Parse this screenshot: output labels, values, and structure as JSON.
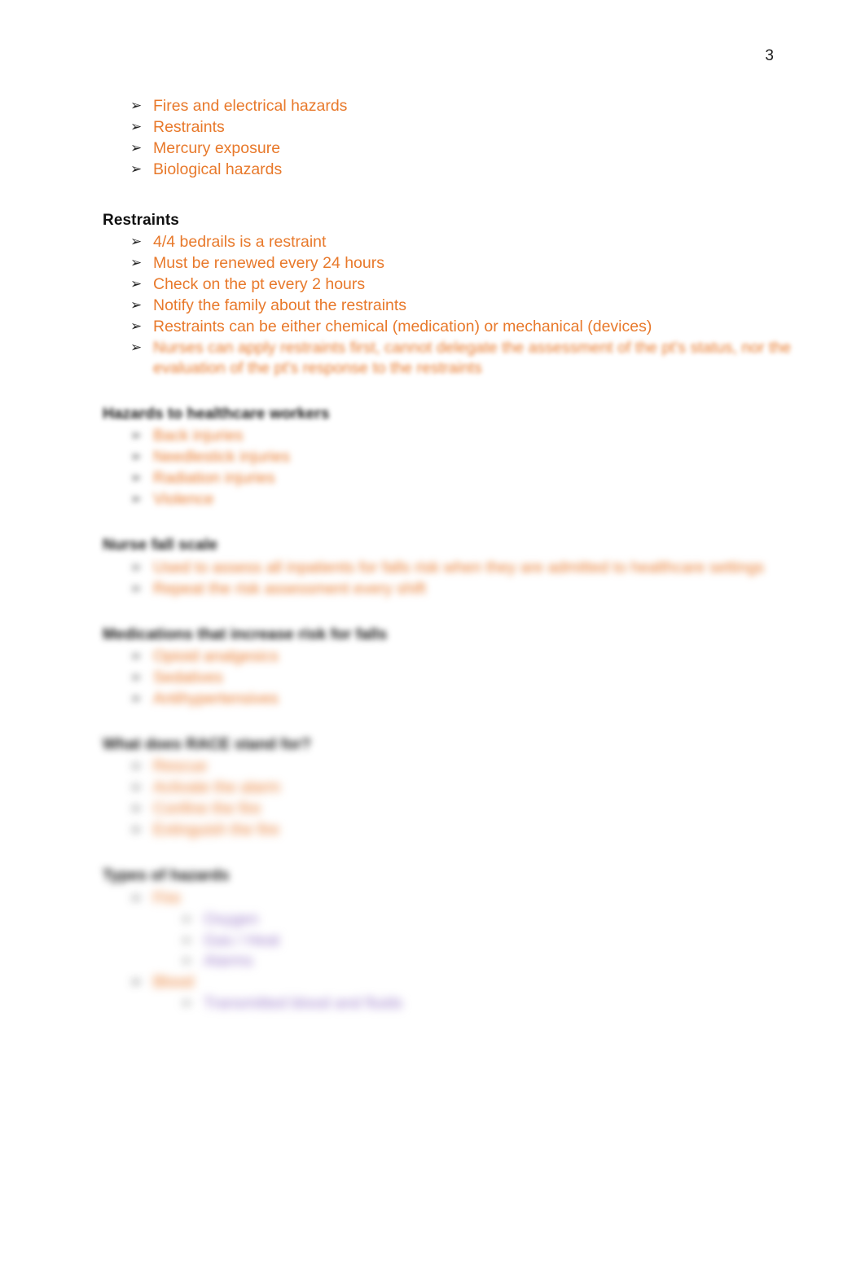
{
  "document": {
    "page_number": "3",
    "colors": {
      "bullet_orange": "#e8792b",
      "bullet_purple": "#9a7bc8",
      "heading_black": "#111111",
      "page_background": "#ffffff"
    },
    "bullet_glyph": "➢"
  },
  "intro_list": {
    "items": [
      {
        "text": "Fires and electrical hazards"
      },
      {
        "text": "Restraints"
      },
      {
        "text": "Mercury exposure"
      },
      {
        "text": "Biological hazards"
      }
    ]
  },
  "sections": [
    {
      "heading": "Restraints",
      "heading_legible": true,
      "items": [
        {
          "text": "4/4 bedrails is a restraint",
          "legible": true
        },
        {
          "text": "Must be renewed every 24 hours",
          "legible": true
        },
        {
          "text": "Check on the pt every 2 hours",
          "legible": true
        },
        {
          "text": "Notify the family about the restraints",
          "legible": true
        },
        {
          "text": "Restraints can be either chemical (medication) or mechanical (devices)",
          "legible": true
        },
        {
          "text": "Nurses can apply restraints first, cannot delegate the assessment of the pt's status, nor the evaluation of the pt's response to the restraints",
          "legible": false
        }
      ]
    },
    {
      "heading": "Hazards to healthcare workers",
      "heading_legible": false,
      "items": [
        {
          "text": "Back injuries",
          "legible": false
        },
        {
          "text": "Needlestick injuries",
          "legible": false
        },
        {
          "text": "Radiation injuries",
          "legible": false
        },
        {
          "text": "Violence",
          "legible": false
        }
      ]
    },
    {
      "heading": "Nurse fall scale",
      "heading_legible": false,
      "items": [
        {
          "text": "Used to assess all inpatients for falls risk when they are admitted to healthcare settings",
          "legible": false
        },
        {
          "text": "Repeat the risk assessment every shift",
          "legible": false
        }
      ]
    },
    {
      "heading": "Medications that increase risk for falls",
      "heading_legible": false,
      "items": [
        {
          "text": "Opioid analgesics",
          "legible": false
        },
        {
          "text": "Sedatives",
          "legible": false
        },
        {
          "text": "Antihypertensives",
          "legible": false
        }
      ]
    },
    {
      "heading": "What does RACE stand for?",
      "heading_legible": false,
      "items": [
        {
          "text": "Rescue",
          "legible": false
        },
        {
          "text": "Activate the alarm",
          "legible": false
        },
        {
          "text": "Confine the fire",
          "legible": false
        },
        {
          "text": "Extinguish the fire",
          "legible": false
        }
      ]
    },
    {
      "heading": "Types of hazards",
      "heading_legible": false,
      "items": [
        {
          "text": "Fire",
          "legible": false,
          "subitems": [
            {
              "text": "Oxygen",
              "legible": false
            },
            {
              "text": "Gas / Heat",
              "legible": false
            },
            {
              "text": "Alarms",
              "legible": false
            }
          ]
        },
        {
          "text": "Blood",
          "legible": false,
          "subitems": [
            {
              "text": "Transmitted blood and fluids",
              "legible": false
            }
          ]
        }
      ]
    }
  ]
}
